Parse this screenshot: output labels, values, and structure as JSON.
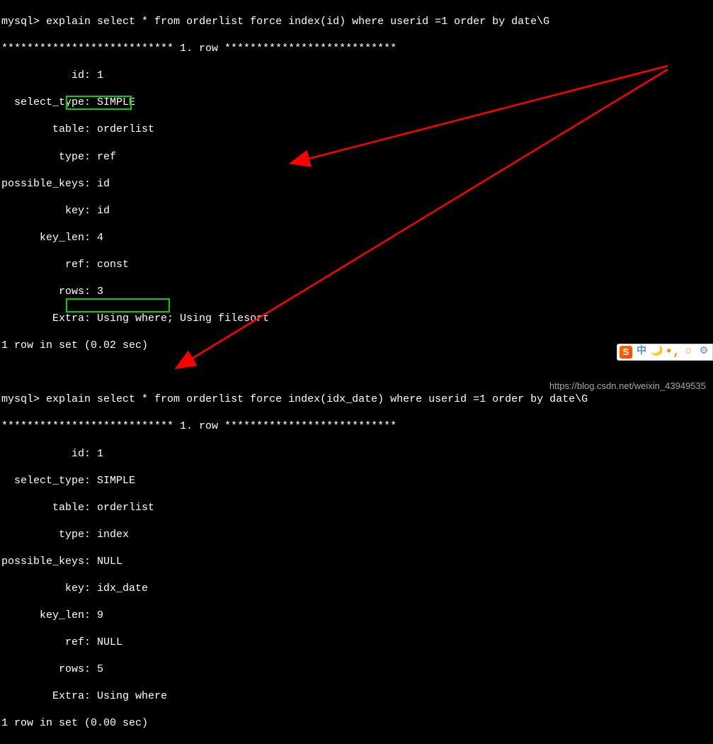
{
  "query1": {
    "prompt": "mysql>",
    "command": "explain select * from orderlist force index(id) where userid =1 order by date\\G",
    "row_separator": "*************************** 1. row ***************************",
    "fields": {
      "id": "1",
      "select_type": "SIMPLE",
      "table": "orderlist",
      "type": "ref",
      "possible_keys": "id",
      "key": "id",
      "key_len": "4",
      "ref": "const",
      "rows": "3",
      "Extra": "Using where; Using filesort"
    },
    "footer": "1 row in set (0.02 sec)"
  },
  "query2": {
    "prompt": "mysql>",
    "command": "explain select * from orderlist force index(idx_date) where userid =1 order by date\\G",
    "row_separator": "*************************** 1. row ***************************",
    "fields": {
      "id": "1",
      "select_type": "SIMPLE",
      "table": "orderlist",
      "type": "index",
      "possible_keys": "NULL",
      "key": "idx_date",
      "key_len": "9",
      "ref": "NULL",
      "rows": "5",
      "Extra": "Using where"
    },
    "footer": "1 row in set (0.00 sec)"
  },
  "watermark": "https://blog.csdn.net/weixin_43949535",
  "toolbar": {
    "sogou": "S",
    "lang": "中",
    "icons": [
      "moon",
      "comma",
      "smile",
      "gear"
    ]
  }
}
